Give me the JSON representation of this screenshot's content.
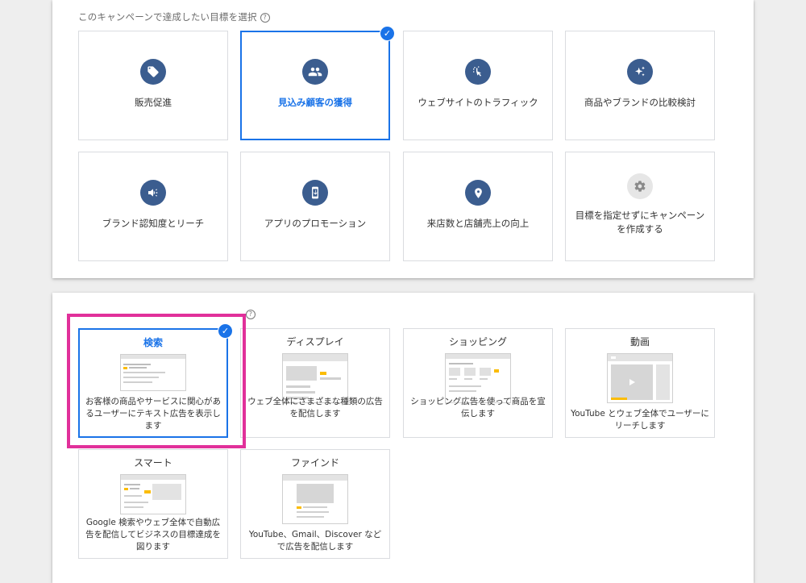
{
  "goal_section": {
    "title": "このキャンペーンで達成したい目標を選択",
    "help_icon": "?",
    "cards": [
      {
        "label": "販売促進",
        "icon": "tag-icon",
        "selected": false
      },
      {
        "label": "見込み顧客の獲得",
        "icon": "people-icon",
        "selected": true
      },
      {
        "label": "ウェブサイトのトラフィック",
        "icon": "cursor-click-icon",
        "selected": false
      },
      {
        "label": "商品やブランドの比較検討",
        "icon": "sparkle-icon",
        "selected": false
      },
      {
        "label": "ブランド認知度とリーチ",
        "icon": "megaphone-icon",
        "selected": false
      },
      {
        "label": "アプリのプロモーション",
        "icon": "phone-icon",
        "selected": false
      },
      {
        "label": "来店数と店舗売上の向上",
        "icon": "location-pin-icon",
        "selected": false
      },
      {
        "label": "目標を指定せずにキャンペーンを作成する",
        "icon": "gear-icon",
        "selected": false
      }
    ]
  },
  "type_section": {
    "help_icon": "?",
    "cards": [
      {
        "title": "検索",
        "desc": "お客様の商品やサービスに関心があるユーザーにテキスト広告を表示します",
        "selected": true
      },
      {
        "title": "ディスプレイ",
        "desc": "ウェブ全体にさまざまな種類の広告を配信します",
        "selected": false
      },
      {
        "title": "ショッピング",
        "desc": "ショッピング広告を使って商品を宣伝します",
        "selected": false
      },
      {
        "title": "動画",
        "desc": "YouTube とウェブ全体でユーザーにリーチします",
        "selected": false
      },
      {
        "title": "スマート",
        "desc": "Google 検索やウェブ全体で自動広告を配信してビジネスの目標達成を図ります",
        "selected": false
      },
      {
        "title": "ファインド",
        "desc": "YouTube、Gmail、Discover などで広告を配信します",
        "selected": false
      }
    ]
  },
  "colors": {
    "accent": "#1a73e8",
    "icon_bg": "#3b5d8f",
    "highlight": "#e1309a",
    "ad_yellow": "#fbbc04"
  }
}
